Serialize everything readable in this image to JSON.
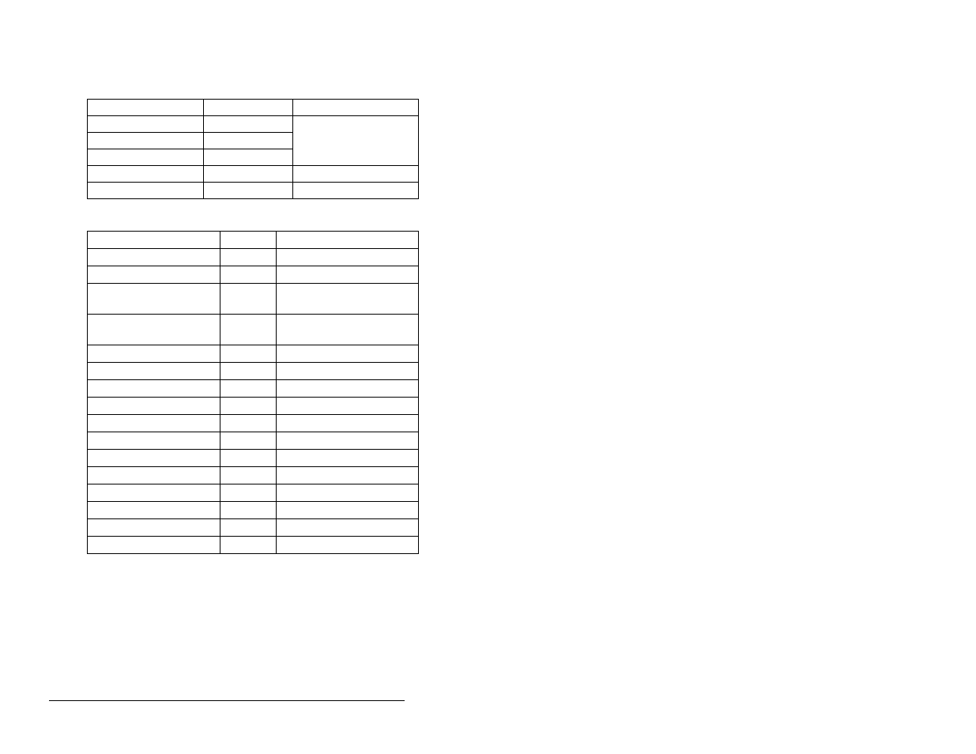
{
  "table1": {
    "columns": [
      "",
      "",
      ""
    ],
    "rows": [
      {
        "c0": "",
        "c1": "",
        "c2": ""
      },
      {
        "c0": "",
        "c1": "",
        "c2_rowspan3": ""
      },
      {
        "c0": "",
        "c1": ""
      },
      {
        "c0": "",
        "c1": ""
      },
      {
        "c0": "",
        "c1": "",
        "c2": ""
      },
      {
        "c0": "",
        "c1": "",
        "c2": ""
      }
    ]
  },
  "table2": {
    "columns": [
      "",
      "",
      ""
    ],
    "rows": [
      {
        "c0": "",
        "c1": "",
        "c2": ""
      },
      {
        "c0": "",
        "c1": "",
        "c2": ""
      },
      {
        "c0": "",
        "c1": "",
        "c2": ""
      },
      {
        "c0": "",
        "c1": "",
        "c2": "",
        "tall": true
      },
      {
        "c0": "",
        "c1": "",
        "c2": "",
        "tall": true
      },
      {
        "c0": "",
        "c1": "",
        "c2": ""
      },
      {
        "c0": "",
        "c1": "",
        "c2": ""
      },
      {
        "c0": "",
        "c1": "",
        "c2": ""
      },
      {
        "c0": "",
        "c1": "",
        "c2": ""
      },
      {
        "c0": "",
        "c1": "",
        "c2": ""
      },
      {
        "c0": "",
        "c1": "",
        "c2": ""
      },
      {
        "c0": "",
        "c1": "",
        "c2": ""
      },
      {
        "c0": "",
        "c1": "",
        "c2": ""
      },
      {
        "c0": "",
        "c1": "",
        "c2": ""
      },
      {
        "c0": "",
        "c1": "",
        "c2": ""
      },
      {
        "c0": "",
        "c1": "",
        "c2": ""
      },
      {
        "c0": "",
        "c1": "",
        "c2": ""
      }
    ]
  }
}
